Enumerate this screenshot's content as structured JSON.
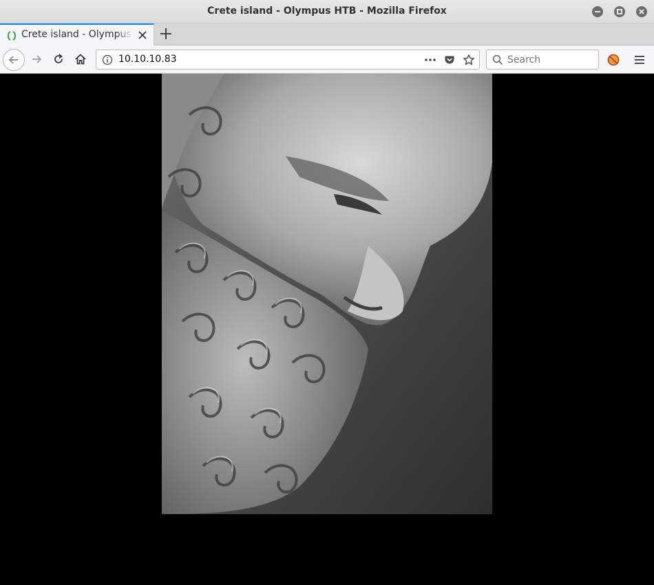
{
  "window": {
    "title": "Crete island - Olympus HTB - Mozilla Firefox"
  },
  "tabs": [
    {
      "label": "Crete island - Olympus HTB",
      "active": true
    }
  ],
  "navbar": {
    "url": "10.10.10.83",
    "search_placeholder": "Search"
  },
  "icons": {
    "favicon": "laurel-wreath-icon",
    "back": "back-arrow-icon",
    "forward": "forward-arrow-icon",
    "reload": "reload-icon",
    "home": "home-icon",
    "site_info": "info-icon",
    "page_actions": "more-icon",
    "pocket": "pocket-icon",
    "bookmark": "star-icon",
    "search": "search-icon",
    "extension": "blocked-extension-icon",
    "menu": "hamburger-menu-icon"
  },
  "colors": {
    "tab_accent": "#0a84ff",
    "page_background": "#000000",
    "favicon_green": "#2e9e3e"
  },
  "content": {
    "image_subject": "grayscale marble statue head with curly beard (Zeus)"
  }
}
